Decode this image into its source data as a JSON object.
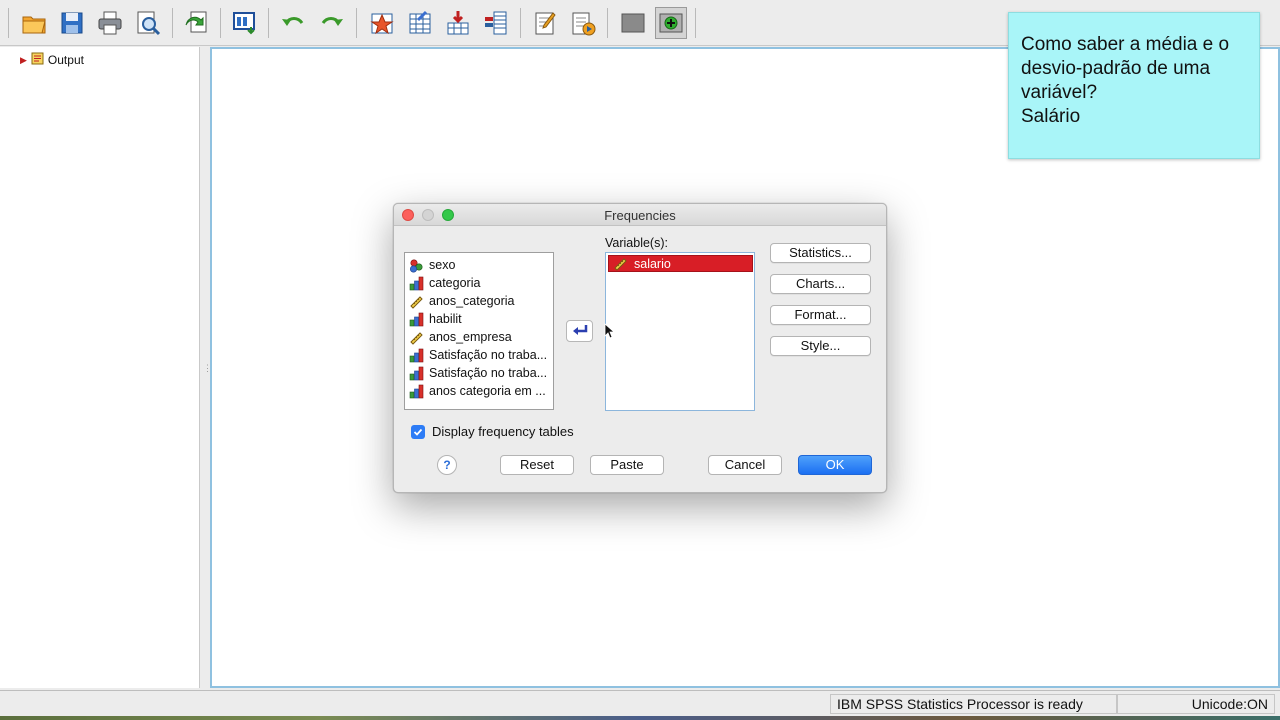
{
  "toolbar": {
    "icons": [
      "open-folder-icon",
      "save-icon",
      "print-icon",
      "print-preview-icon",
      "export-icon",
      "recall-dialog-icon",
      "undo-icon",
      "redo-icon",
      "goto-case-icon",
      "goto-variable-icon",
      "insert-output-icon",
      "designate-window-icon",
      "create-title-icon",
      "create-text-icon",
      "hide-icon",
      "show-icon"
    ]
  },
  "outline": {
    "root_label": "Output"
  },
  "note": {
    "text": "Como saber a média e o\ndesvio-padrão de uma\nvariável?\nSalário"
  },
  "dialog": {
    "title": "Frequencies",
    "source_variables": [
      {
        "label": "sexo",
        "icon": "nominal-icon"
      },
      {
        "label": "categoria",
        "icon": "ordinal-icon"
      },
      {
        "label": "anos_categoria",
        "icon": "scale-icon"
      },
      {
        "label": "habilit",
        "icon": "ordinal-icon"
      },
      {
        "label": "anos_empresa",
        "icon": "scale-icon"
      },
      {
        "label": "Satisfação no traba...",
        "icon": "ordinal-icon"
      },
      {
        "label": "Satisfação no traba...",
        "icon": "ordinal-icon"
      },
      {
        "label": "anos categoria em ...",
        "icon": "ordinal-icon"
      }
    ],
    "variables_label": "Variable(s):",
    "selected_variables": [
      {
        "label": "salario",
        "icon": "scale-icon"
      }
    ],
    "side_buttons": {
      "statistics": "Statistics...",
      "charts": "Charts...",
      "format": "Format...",
      "style": "Style..."
    },
    "display_frequency_tables": {
      "label": "Display frequency tables",
      "checked": true
    },
    "help": "?",
    "buttons": {
      "reset": "Reset",
      "paste": "Paste",
      "cancel": "Cancel",
      "ok": "OK"
    }
  },
  "status": {
    "message": "IBM SPSS Statistics Processor is ready",
    "unicode": "Unicode:ON"
  }
}
